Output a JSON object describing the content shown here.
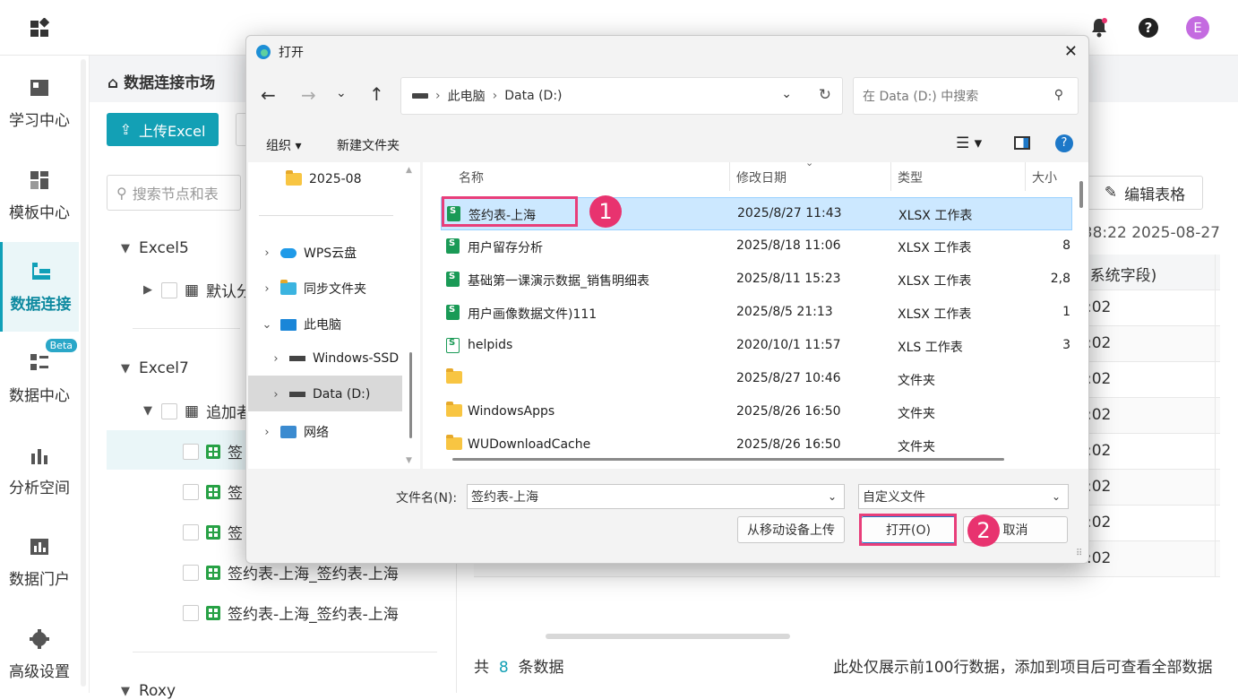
{
  "app": {
    "crumb": "数据连接市场",
    "upload": "上传Excel",
    "search_placeholder": "搜索节点和表",
    "edit": "编辑表格",
    "timestamp": "2025-08-27 11:38:22",
    "header_partial": "(系统字段)",
    "cell_partial": ":02",
    "footer_total_prefix": "共",
    "footer_total": "8",
    "footer_total_suffix": "条数据",
    "footer_note": "此处仅展示前100行数据，添加到项目后可查看全部数据"
  },
  "nav": [
    {
      "label": "学习中心"
    },
    {
      "label": "模板中心"
    },
    {
      "label": "数据连接"
    },
    {
      "label": "数据中心",
      "badge": "Beta"
    },
    {
      "label": "分析空间"
    },
    {
      "label": "数据门户"
    },
    {
      "label": "高级设置"
    }
  ],
  "tree": {
    "excel5": "Excel5",
    "default_partial": "默认分",
    "excel7": "Excel7",
    "append_partial": "追加者",
    "sheet_partial": "签",
    "sheet_full": "签约表-上海_签约表-上海",
    "roxy": "Roxy"
  },
  "dialog": {
    "title": "打开",
    "path": [
      "此电脑",
      "Data (D:)"
    ],
    "search_placeholder": "在 Data (D:) 中搜索",
    "organize": "组织",
    "new_folder": "新建文件夹",
    "left": [
      "2025-08",
      "WPS云盘",
      "同步文件夹",
      "此电脑",
      "Windows-SSD",
      "Data (D:)",
      "网络"
    ],
    "columns": {
      "name": "名称",
      "date": "修改日期",
      "type": "类型",
      "size": "大小"
    },
    "files": [
      {
        "name": "签约表-上海",
        "date": "2025/8/27 11:43",
        "type": "XLSX 工作表",
        "size": "",
        "icon": "xls-green"
      },
      {
        "name": "用户留存分析",
        "date": "2025/8/18 11:06",
        "type": "XLSX 工作表",
        "size": "8",
        "icon": "xls-green"
      },
      {
        "name": "基础第一课演示数据_销售明细表",
        "date": "2025/8/11 15:23",
        "type": "XLSX 工作表",
        "size": "2,8",
        "icon": "xls-green"
      },
      {
        "name": "用户画像数据文件)111",
        "date": "2025/8/5 21:13",
        "type": "XLSX 工作表",
        "size": "1",
        "icon": "xls-green"
      },
      {
        "name": "helpids",
        "date": "2020/10/1 11:57",
        "type": "XLS 工作表",
        "size": "3",
        "icon": "xls-outline"
      },
      {
        "name": "",
        "date": "2025/8/27 10:46",
        "type": "文件夹",
        "size": "",
        "icon": "folder"
      },
      {
        "name": "WindowsApps",
        "date": "2025/8/26 16:50",
        "type": "文件夹",
        "size": "",
        "icon": "folder"
      },
      {
        "name": "WUDownloadCache",
        "date": "2025/8/26 16:50",
        "type": "文件夹",
        "size": "",
        "icon": "folder"
      }
    ],
    "filename_label": "文件名(N):",
    "filename": "签约表-上海",
    "filter": "自定义文件",
    "mobile_upload": "从移动设备上传",
    "open": "打开(O)",
    "cancel": "取消",
    "badge1": "1",
    "badge2": "2"
  },
  "colors": {
    "accent": "#13a0b5",
    "marker": "#e8336f"
  }
}
